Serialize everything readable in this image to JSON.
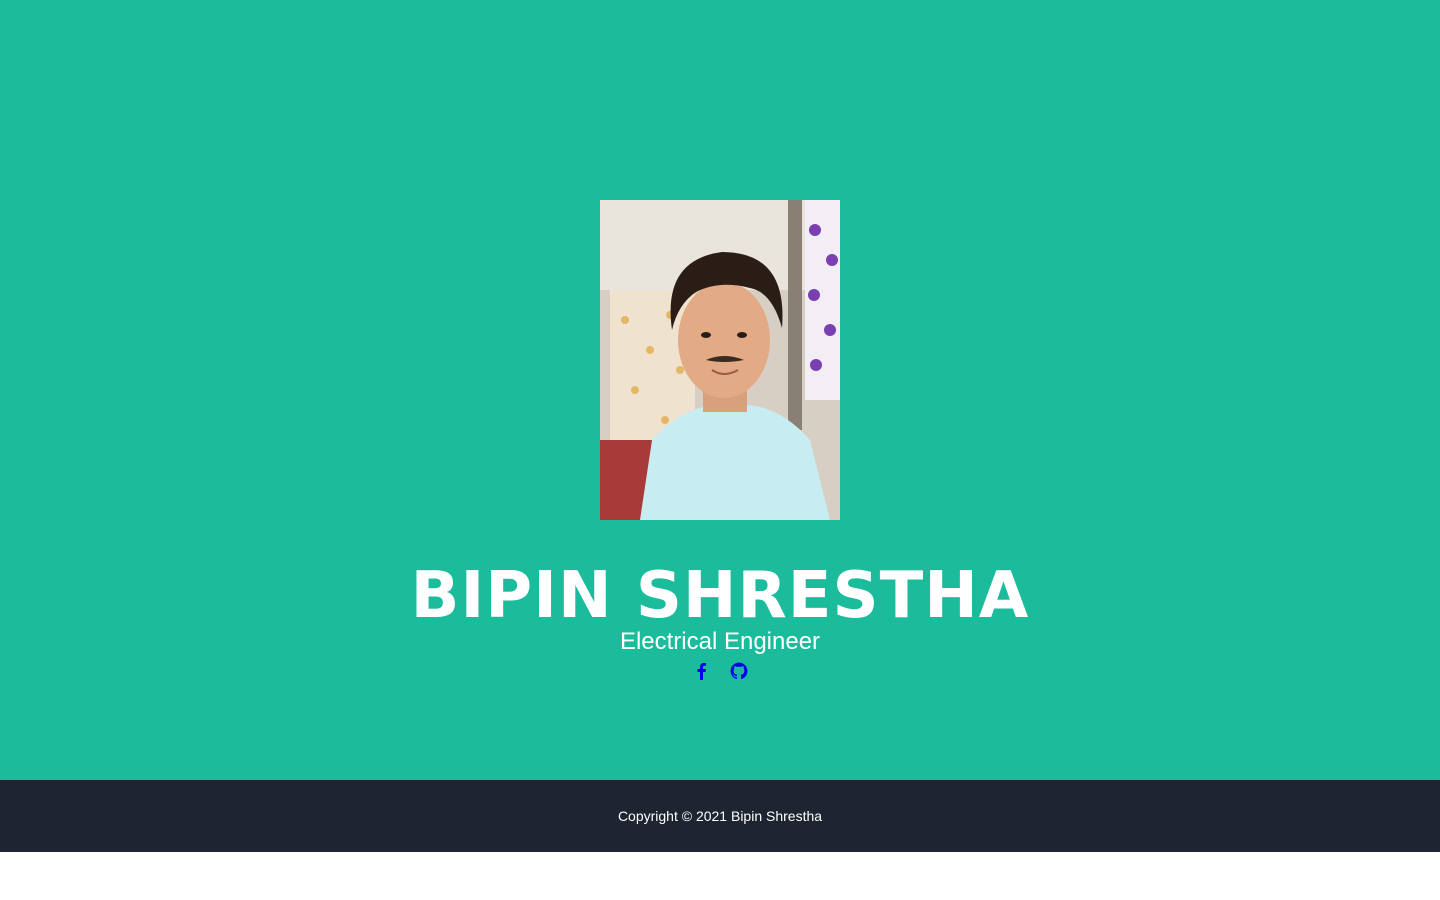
{
  "colors": {
    "masthead_bg": "#1abc9c",
    "footer_bg": "#1e2530",
    "text": "#ffffff",
    "social_icon": "#0000ee"
  },
  "profile": {
    "photo_alt": "portrait-photo",
    "name": "BIPIN SHRESTHA",
    "title": "Electrical Engineer"
  },
  "social": [
    {
      "icon": "facebook-icon"
    },
    {
      "icon": "github-icon"
    }
  ],
  "footer": {
    "copyright": "Copyright © 2021 Bipin Shrestha"
  }
}
